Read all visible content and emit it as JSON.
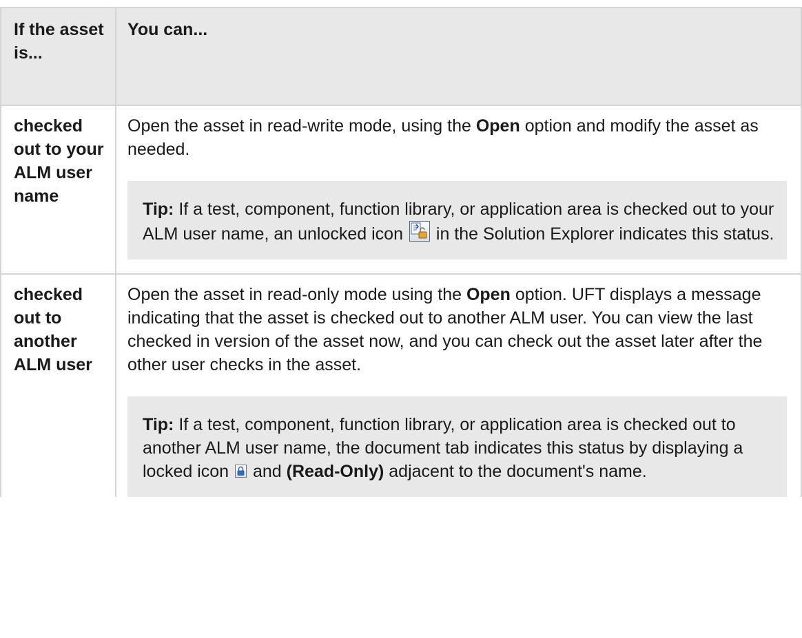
{
  "table": {
    "headers": [
      "If the asset is...",
      "You can..."
    ],
    "rows": [
      {
        "condition": "checked out to your ALM user name",
        "description": {
          "before": "Open the asset in read-write mode, using the ",
          "bold": "Open",
          "after": " option and modify the asset as needed."
        },
        "tip": {
          "label": "Tip:",
          "text_before_icon": " If a test, component, function library, or application area is checked out to your ALM user name, an unlocked icon ",
          "icon": "unlocked-icon",
          "text_after_icon": " in the Solution Explorer indicates this status."
        }
      },
      {
        "condition": "checked out to another ALM user",
        "description": {
          "before": "Open the asset in read-only mode using the ",
          "bold": "Open",
          "after": " option. UFT displays a message indicating that the asset is checked out to another ALM user. You can view the last checked in version of the asset now, and you can check out the asset later after the other user checks in the asset."
        },
        "tip": {
          "label": "Tip:",
          "text_before_icon": " If a test, component, function library, or application area is checked out to another ALM user name, the document tab indicates this status by displaying a locked icon ",
          "icon": "locked-icon",
          "text_mid": " and ",
          "bold_after_icon": "(Read-Only)",
          "text_after_icon": " adjacent to the document's name."
        }
      }
    ]
  },
  "colors": {
    "header_bg": "#e8e8e8",
    "tip_bg": "#e8e8e8",
    "border": "#d4d4d4"
  }
}
